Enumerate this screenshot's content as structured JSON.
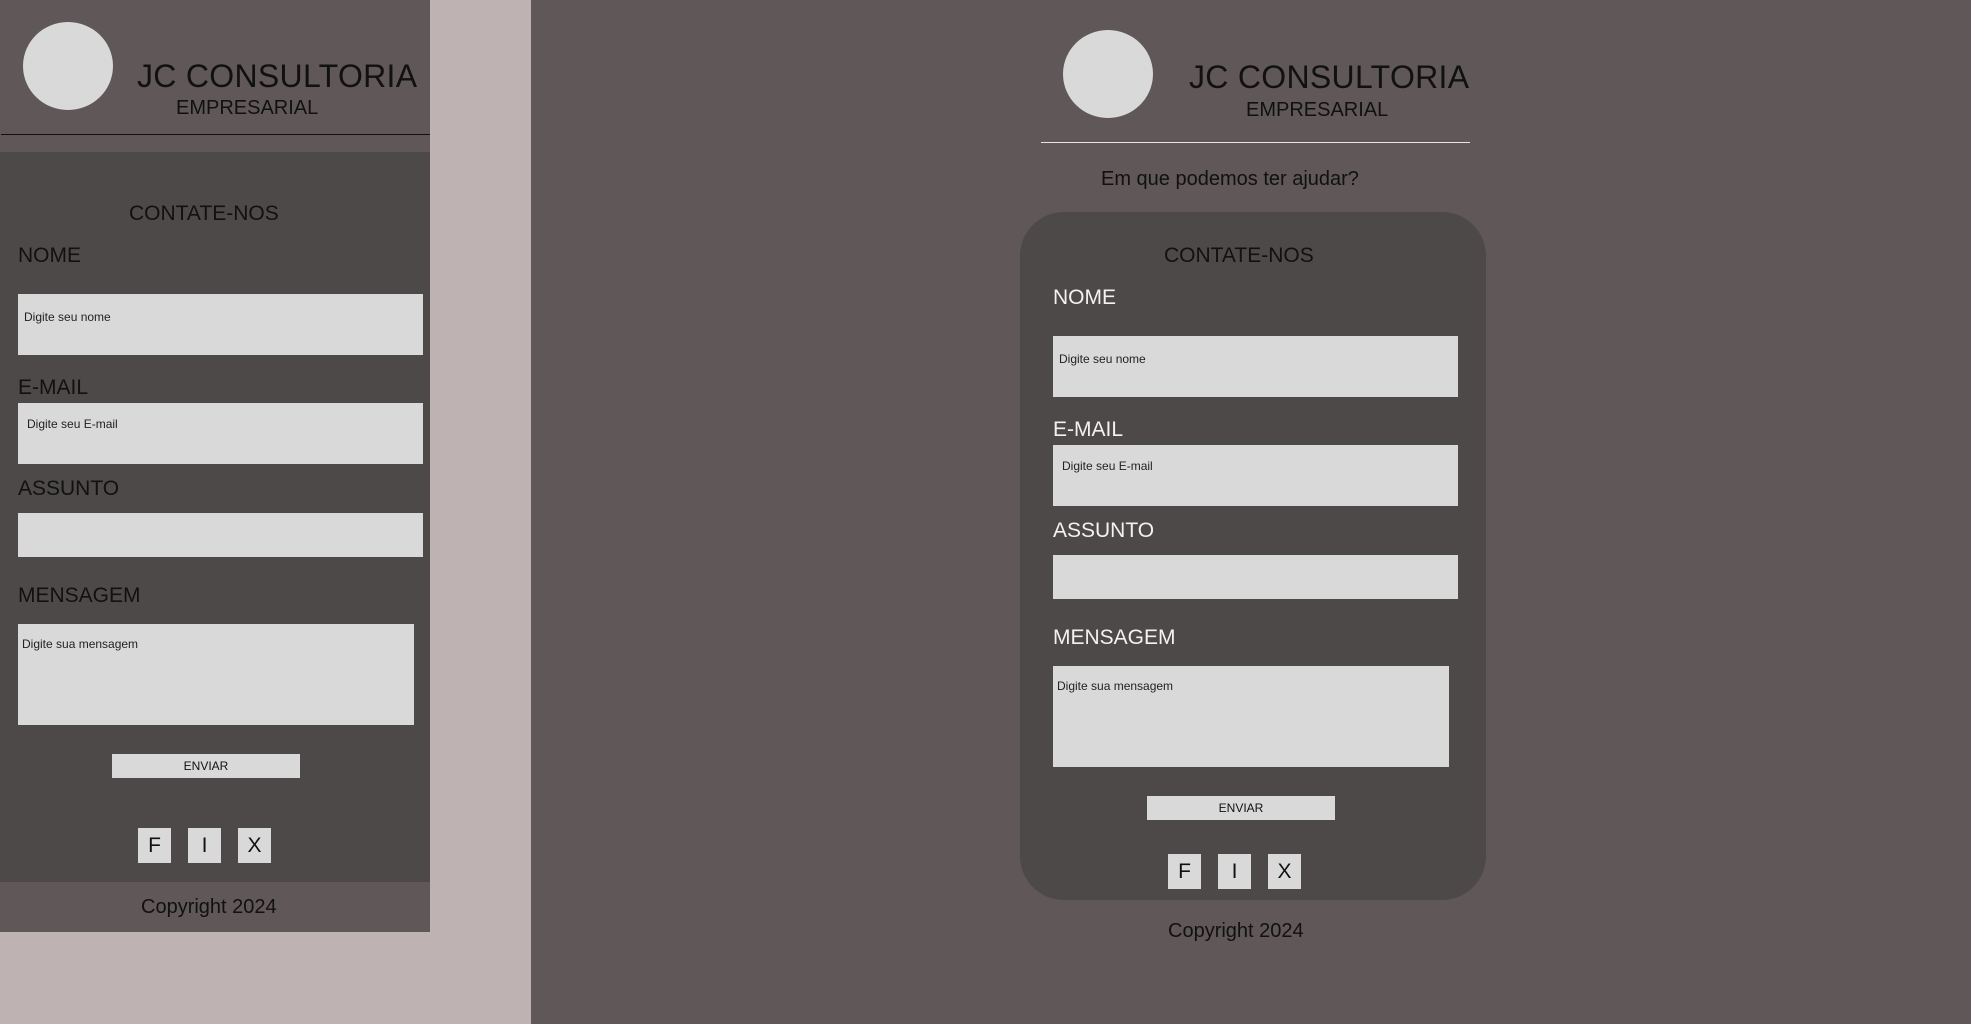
{
  "brand": {
    "name": "JC CONSULTORIA",
    "tagline": "EMPRESARIAL"
  },
  "question": "Em que  podemos ter ajudar?",
  "contact": {
    "title": "CONTATE-NOS",
    "name_label": "NOME",
    "name_placeholder": "Digite seu nome",
    "email_label": "E-MAIL",
    "email_placeholder": "Digite seu E-mail",
    "subject_label": "ASSUNTO",
    "subject_value": "",
    "message_label": "MENSAGEM",
    "message_placeholder": "Digite sua mensagem",
    "submit_label": "ENVIAR"
  },
  "social": {
    "facebook": "F",
    "instagram": "I",
    "x": "X"
  },
  "footer": {
    "copyright": "Copyright 2024"
  },
  "colors": {
    "canvas": "#bfb2b3",
    "frame": "#5f5758",
    "panel": "#4d4948",
    "field": "#d9d9d9"
  }
}
